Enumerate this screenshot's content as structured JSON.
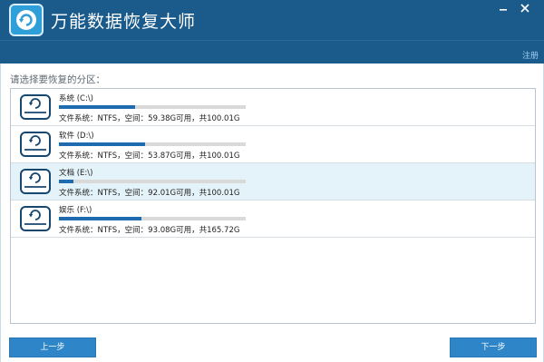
{
  "app": {
    "title": "万能数据恢复大师",
    "logo_icon": "refresh-circle-icon",
    "register_label": "注册"
  },
  "window_controls": {
    "minimize_icon": "minimize-icon",
    "close_icon": "close-icon"
  },
  "colors": {
    "titlebar": "#1b5b8c",
    "accent": "#2e86c8",
    "usage_bar": "#1e6bb0",
    "selected_row": "#e4f3fa"
  },
  "partition_list": {
    "prompt": "请选择要恢复的分区：",
    "selected_index": 2,
    "items": [
      {
        "name": "系统 (C:\\)",
        "info": "文件系统：NTFS，空间：59.38G可用，共100.01G",
        "used_percent": 41
      },
      {
        "name": "软件 (D:\\)",
        "info": "文件系统：NTFS，空间：53.87G可用，共100.01G",
        "used_percent": 46
      },
      {
        "name": "文档 (E:\\)",
        "info": "文件系统：NTFS，空间：92.01G可用，共100.01G",
        "used_percent": 8
      },
      {
        "name": "娱乐 (F:\\)",
        "info": "文件系统：NTFS，空间：93.08G可用，共165.72G",
        "used_percent": 44
      }
    ]
  },
  "footer": {
    "prev_label": "上一步",
    "next_label": "下一步"
  }
}
